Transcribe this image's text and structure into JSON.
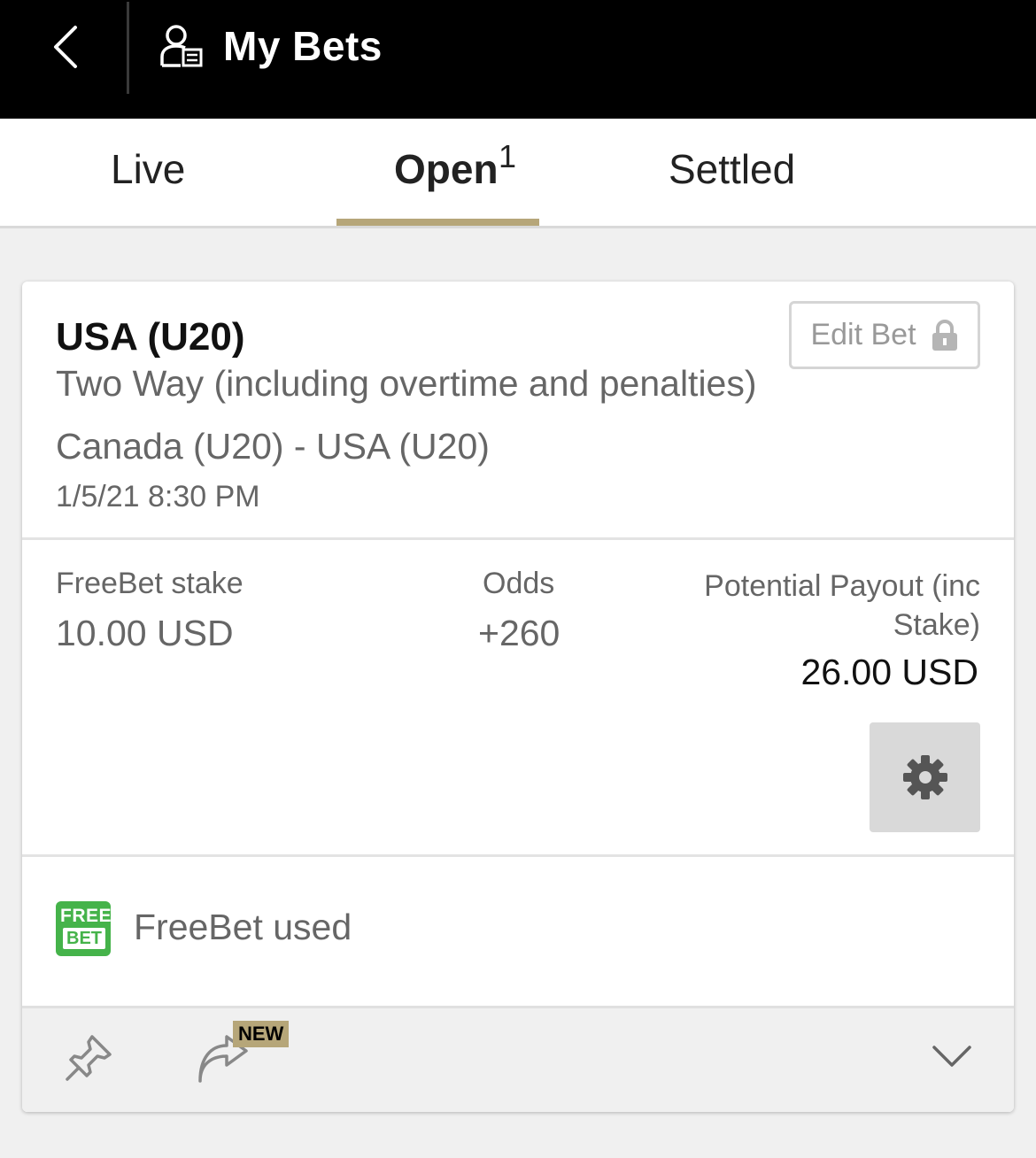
{
  "header": {
    "title": "My Bets",
    "back_icon": "chevron-left-icon",
    "user_icon": "user-bets-icon",
    "background": "#000000"
  },
  "tabs": {
    "items": [
      {
        "label": "Live"
      },
      {
        "label": "Open",
        "count": "1"
      },
      {
        "label": "Settled"
      }
    ],
    "active": "Open",
    "accent": "#b6a679"
  },
  "bet": {
    "selection": "USA (U20)",
    "market": "Two Way (including overtime and penalties)",
    "event": "Canada (U20) - USA (U20)",
    "datetime": "1/5/21 8:30 PM",
    "edit_label": "Edit Bet",
    "stake_label": "FreeBet stake",
    "stake_value": "10.00 USD",
    "odds_label": "Odds",
    "odds_value": "+260",
    "payout_label": "Potential Payout (inc Stake)",
    "payout_value": "26.00 USD",
    "freebet_badge_top": "FREE",
    "freebet_badge_bottom": "BET",
    "freebet_text": "FreeBet used",
    "new_badge": "NEW"
  },
  "colors": {
    "freebet_green": "#45b34a",
    "gold": "#b6a679"
  }
}
